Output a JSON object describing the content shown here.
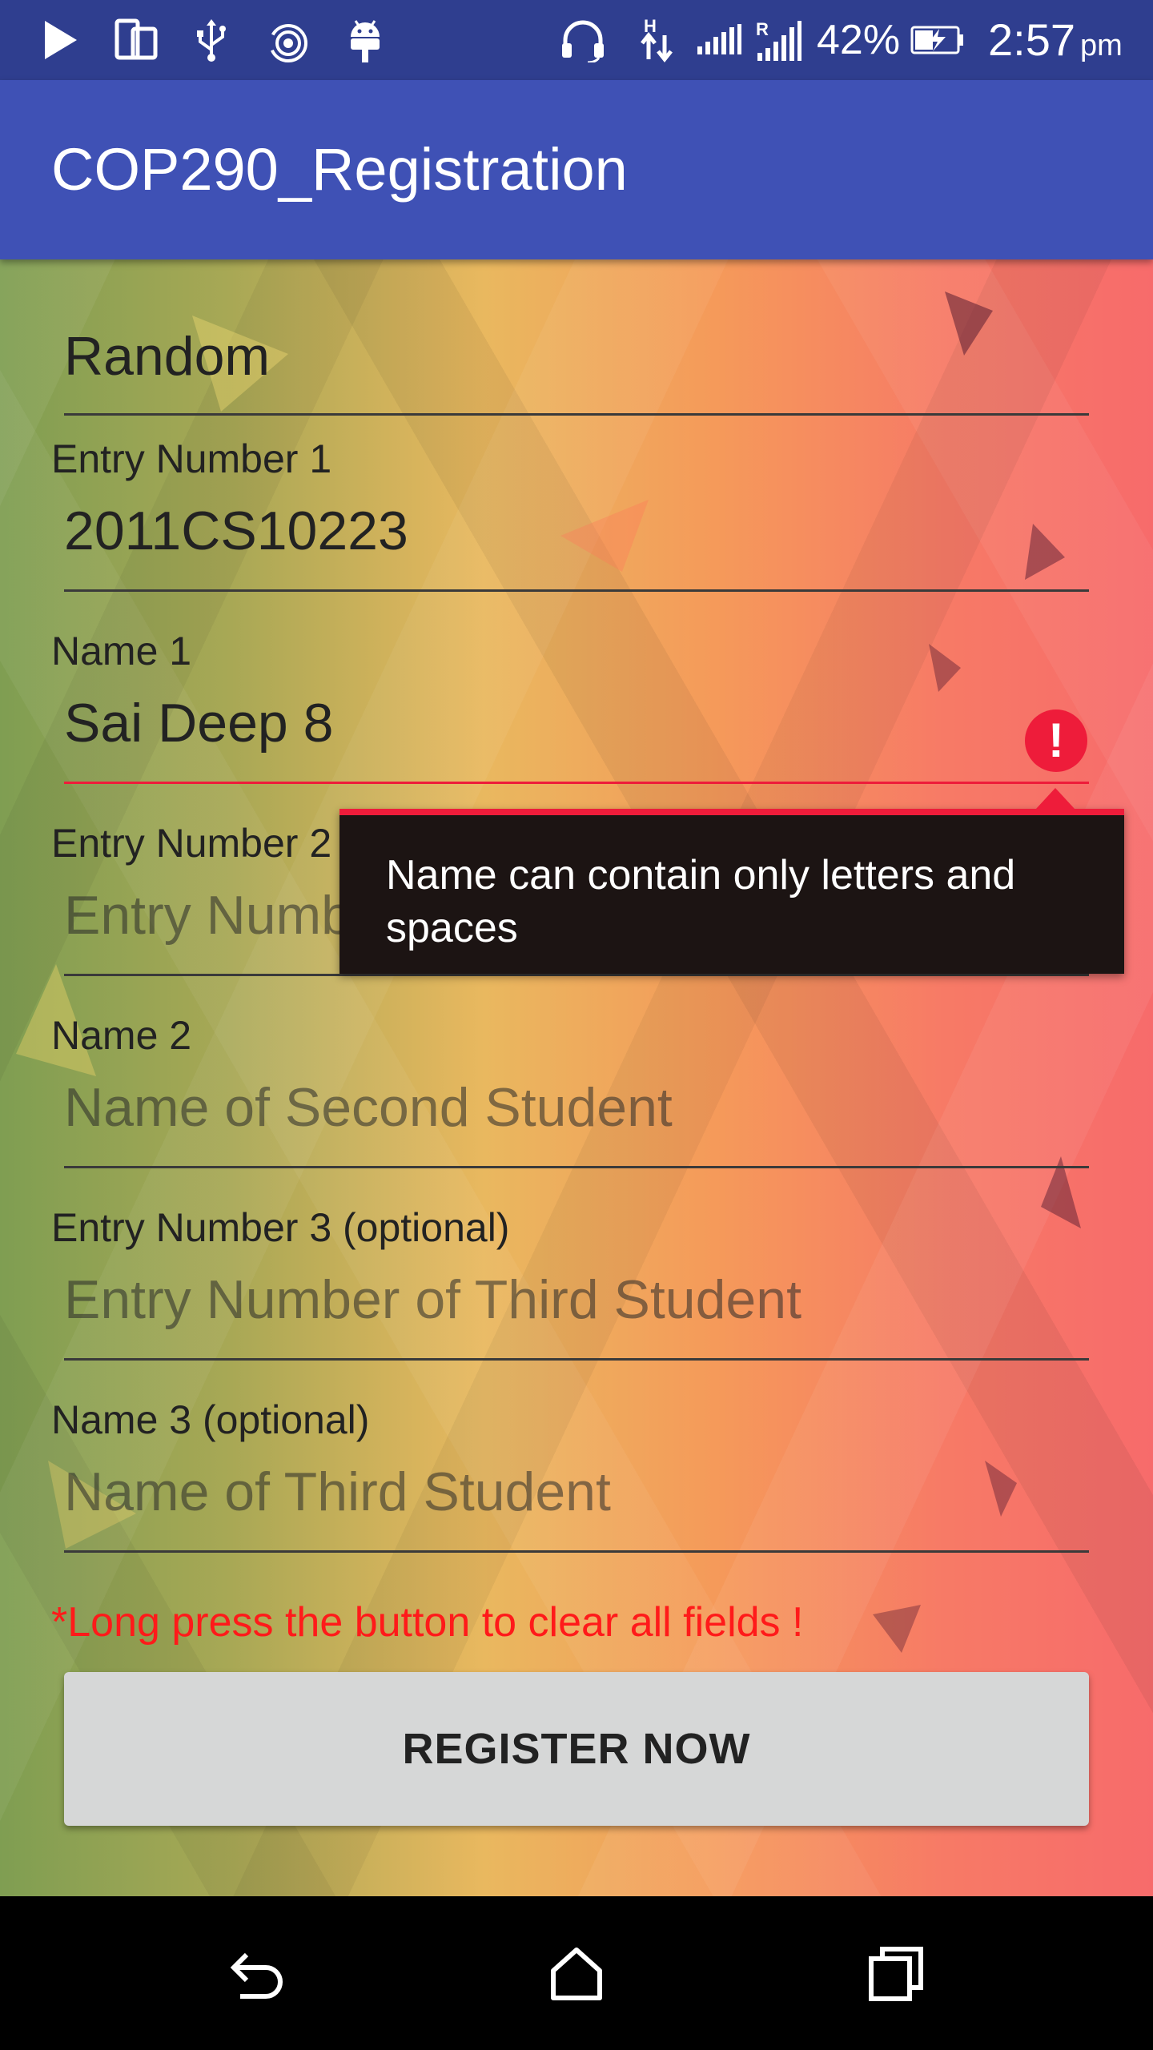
{
  "status_bar": {
    "battery_percent": "42%",
    "time": "2:57",
    "ampm": "pm",
    "icons": [
      "play-icon",
      "device-icon",
      "usb-icon",
      "hotspot-icon",
      "android-icon",
      "headset-icon",
      "h-data-icon",
      "signal-icon",
      "roaming-signal-icon",
      "battery-charging-icon"
    ]
  },
  "app_bar": {
    "title": "COP290_Registration"
  },
  "form": {
    "team_name": {
      "value": "Random"
    },
    "entry1": {
      "label": "Entry Number 1",
      "value": "2011CS10223"
    },
    "name1": {
      "label": "Name 1",
      "value": "Sai Deep 8",
      "error": "Name can contain only letters and spaces"
    },
    "entry2": {
      "label": "Entry Number 2",
      "placeholder": "Entry Number of Second Student"
    },
    "name2": {
      "label": "Name 2",
      "placeholder": "Name of Second Student"
    },
    "entry3": {
      "label": "Entry Number 3 (optional)",
      "placeholder": "Entry Number of Third Student"
    },
    "name3": {
      "label": "Name 3 (optional)",
      "placeholder": "Name of Third Student"
    },
    "hint": "*Long press the button to clear all fields !",
    "register_label": "REGISTER NOW"
  },
  "nav_bar": {
    "icons": [
      "back-icon",
      "home-icon",
      "recents-icon"
    ]
  },
  "colors": {
    "status_bar": "#2f3e8f",
    "app_bar": "#3f51b5",
    "error": "#ee1c3a",
    "hint": "#ff1a1a",
    "button": "#d6d7d7"
  }
}
